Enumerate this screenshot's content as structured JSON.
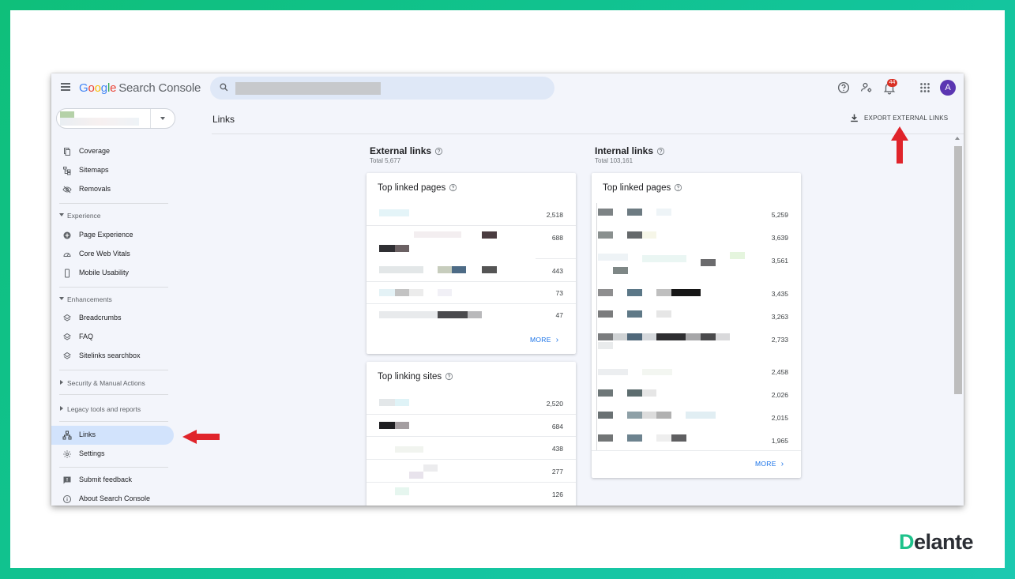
{
  "app": {
    "logo": {
      "g1": "G",
      "g2": "o",
      "g3": "o",
      "g4": "g",
      "g5": "l",
      "g6": "e",
      "product": "Search Console"
    },
    "notifications_count": "44",
    "avatar_letter": "A"
  },
  "sidebar": {
    "items_index": [
      {
        "label": "Coverage",
        "icon": "coverage-icon"
      },
      {
        "label": "Sitemaps",
        "icon": "sitemaps-icon"
      },
      {
        "label": "Removals",
        "icon": "removals-icon"
      }
    ],
    "section_experience": "Experience",
    "items_experience": [
      {
        "label": "Page Experience",
        "icon": "page-experience-icon"
      },
      {
        "label": "Core Web Vitals",
        "icon": "gauge-icon"
      },
      {
        "label": "Mobile Usability",
        "icon": "phone-icon"
      }
    ],
    "section_enhancements": "Enhancements",
    "items_enhancements": [
      {
        "label": "Breadcrumbs",
        "icon": "layers-icon"
      },
      {
        "label": "FAQ",
        "icon": "layers-icon"
      },
      {
        "label": "Sitelinks searchbox",
        "icon": "layers-icon"
      }
    ],
    "section_security": "Security & Manual Actions",
    "section_legacy": "Legacy tools and reports",
    "links": "Links",
    "settings": "Settings",
    "submit_feedback": "Submit feedback",
    "about": "About Search Console"
  },
  "page": {
    "title": "Links",
    "export_label": "EXPORT EXTERNAL LINKS"
  },
  "external": {
    "title": "External links",
    "total": "Total 5,677",
    "top_linked_pages": {
      "title": "Top linked pages",
      "values": [
        "2,518",
        "688",
        "443",
        "73",
        "47"
      ],
      "more": "MORE"
    },
    "top_linking_sites": {
      "title": "Top linking sites",
      "values": [
        "2,520",
        "684",
        "438",
        "277",
        "126"
      ]
    }
  },
  "internal": {
    "title": "Internal links",
    "total": "Total 103,161",
    "top_linked_pages": {
      "title": "Top linked pages",
      "values": [
        "5,259",
        "3,639",
        "3,561",
        "3,435",
        "3,263",
        "2,733",
        "2,458",
        "2,026",
        "2,015",
        "1,965"
      ],
      "more": "MORE"
    }
  },
  "brand": {
    "first": "D",
    "rest": "elante"
  },
  "colors": {
    "accent": "#1a73e8",
    "active_nav": "#d2e3fc",
    "border_gradient": "#12c49a",
    "arrow": "#e0242b"
  }
}
